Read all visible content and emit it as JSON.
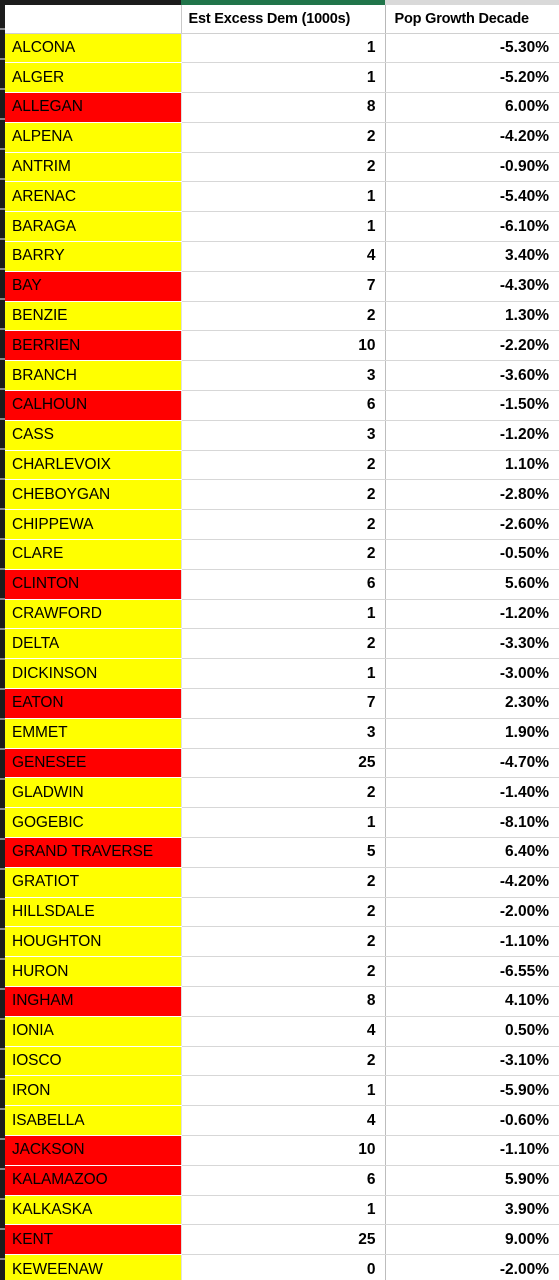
{
  "sheet": {
    "title": "County Excess Demand Table",
    "accent_green": "#21754a",
    "fill_yellow": "#ffff00",
    "fill_red": "#ff0000"
  },
  "table": {
    "columns": [
      {
        "key": "county",
        "label": "",
        "align": "left"
      },
      {
        "key": "est_excess_dem_1000s",
        "label": "Est Excess Dem (1000s)",
        "align": "right"
      },
      {
        "key": "pop_growth_decade",
        "label": "Pop Growth Decade",
        "align": "right"
      }
    ],
    "rows": [
      {
        "county": "ALCONA",
        "est": "1",
        "pop": "-5.30%",
        "fill": "yellow"
      },
      {
        "county": "ALGER",
        "est": "1",
        "pop": "-5.20%",
        "fill": "yellow"
      },
      {
        "county": "ALLEGAN",
        "est": "8",
        "pop": "6.00%",
        "fill": "red"
      },
      {
        "county": "ALPENA",
        "est": "2",
        "pop": "-4.20%",
        "fill": "yellow"
      },
      {
        "county": "ANTRIM",
        "est": "2",
        "pop": "-0.90%",
        "fill": "yellow"
      },
      {
        "county": "ARENAC",
        "est": "1",
        "pop": "-5.40%",
        "fill": "yellow"
      },
      {
        "county": "BARAGA",
        "est": "1",
        "pop": "-6.10%",
        "fill": "yellow"
      },
      {
        "county": "BARRY",
        "est": "4",
        "pop": "3.40%",
        "fill": "yellow"
      },
      {
        "county": "BAY",
        "est": "7",
        "pop": "-4.30%",
        "fill": "red"
      },
      {
        "county": "BENZIE",
        "est": "2",
        "pop": "1.30%",
        "fill": "yellow"
      },
      {
        "county": "BERRIEN",
        "est": "10",
        "pop": "-2.20%",
        "fill": "red"
      },
      {
        "county": "BRANCH",
        "est": "3",
        "pop": "-3.60%",
        "fill": "yellow"
      },
      {
        "county": "CALHOUN",
        "est": "6",
        "pop": "-1.50%",
        "fill": "red"
      },
      {
        "county": "CASS",
        "est": "3",
        "pop": "-1.20%",
        "fill": "yellow"
      },
      {
        "county": "CHARLEVOIX",
        "est": "2",
        "pop": "1.10%",
        "fill": "yellow"
      },
      {
        "county": "CHEBOYGAN",
        "est": "2",
        "pop": "-2.80%",
        "fill": "yellow"
      },
      {
        "county": "CHIPPEWA",
        "est": "2",
        "pop": "-2.60%",
        "fill": "yellow"
      },
      {
        "county": "CLARE",
        "est": "2",
        "pop": "-0.50%",
        "fill": "yellow"
      },
      {
        "county": "CLINTON",
        "est": "6",
        "pop": "5.60%",
        "fill": "red"
      },
      {
        "county": "CRAWFORD",
        "est": "1",
        "pop": "-1.20%",
        "fill": "yellow"
      },
      {
        "county": "DELTA",
        "est": "2",
        "pop": "-3.30%",
        "fill": "yellow"
      },
      {
        "county": "DICKINSON",
        "est": "1",
        "pop": "-3.00%",
        "fill": "yellow"
      },
      {
        "county": "EATON",
        "est": "7",
        "pop": "2.30%",
        "fill": "red"
      },
      {
        "county": "EMMET",
        "est": "3",
        "pop": "1.90%",
        "fill": "yellow"
      },
      {
        "county": "GENESEE",
        "est": "25",
        "pop": "-4.70%",
        "fill": "red"
      },
      {
        "county": "GLADWIN",
        "est": "2",
        "pop": "-1.40%",
        "fill": "yellow"
      },
      {
        "county": "GOGEBIC",
        "est": "1",
        "pop": "-8.10%",
        "fill": "yellow"
      },
      {
        "county": "GRAND TRAVERSE",
        "est": "5",
        "pop": "6.40%",
        "fill": "red"
      },
      {
        "county": "GRATIOT",
        "est": "2",
        "pop": "-4.20%",
        "fill": "yellow"
      },
      {
        "county": "HILLSDALE",
        "est": "2",
        "pop": "-2.00%",
        "fill": "yellow"
      },
      {
        "county": "HOUGHTON",
        "est": "2",
        "pop": "-1.10%",
        "fill": "yellow"
      },
      {
        "county": "HURON",
        "est": "2",
        "pop": "-6.55%",
        "fill": "yellow"
      },
      {
        "county": "INGHAM",
        "est": "8",
        "pop": "4.10%",
        "fill": "red"
      },
      {
        "county": "IONIA",
        "est": "4",
        "pop": "0.50%",
        "fill": "yellow"
      },
      {
        "county": "IOSCO",
        "est": "2",
        "pop": "-3.10%",
        "fill": "yellow"
      },
      {
        "county": "IRON",
        "est": "1",
        "pop": "-5.90%",
        "fill": "yellow"
      },
      {
        "county": "ISABELLA",
        "est": "4",
        "pop": "-0.60%",
        "fill": "yellow"
      },
      {
        "county": "JACKSON",
        "est": "10",
        "pop": "-1.10%",
        "fill": "red"
      },
      {
        "county": "KALAMAZOO",
        "est": "6",
        "pop": "5.90%",
        "fill": "red"
      },
      {
        "county": "KALKASKA",
        "est": "1",
        "pop": "3.90%",
        "fill": "yellow"
      },
      {
        "county": "KENT",
        "est": "25",
        "pop": "9.00%",
        "fill": "red"
      },
      {
        "county": "KEWEENAW",
        "est": "0",
        "pop": "-2.00%",
        "fill": "yellow"
      }
    ]
  }
}
